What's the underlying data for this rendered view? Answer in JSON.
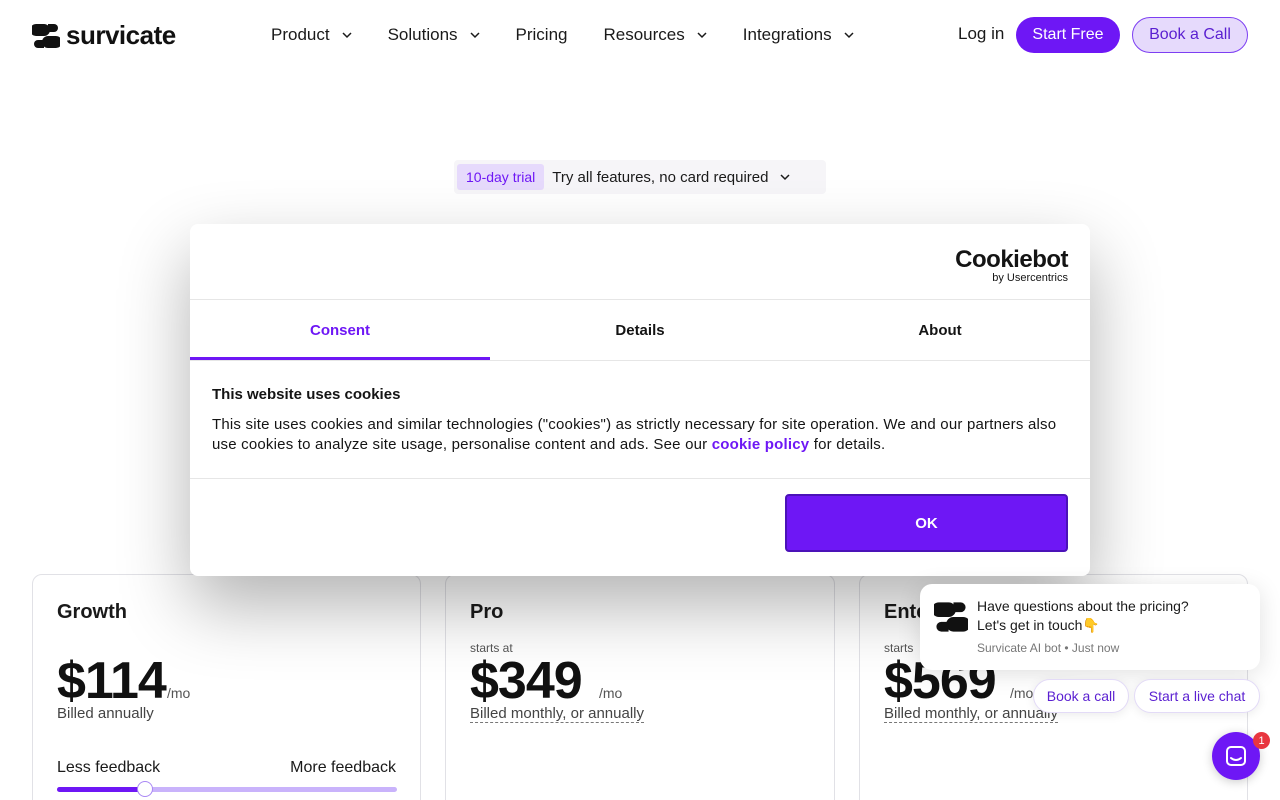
{
  "header": {
    "logo_text": "survicate",
    "menu": [
      {
        "label": "Product",
        "has_dropdown": true
      },
      {
        "label": "Solutions",
        "has_dropdown": true
      },
      {
        "label": "Pricing",
        "has_dropdown": false
      },
      {
        "label": "Resources",
        "has_dropdown": true
      },
      {
        "label": "Integrations",
        "has_dropdown": true
      }
    ],
    "login": "Log in",
    "start_free": "Start Free",
    "book_call": "Book a Call"
  },
  "trial": {
    "tag": "10-day trial",
    "text": "Try all features, no card required"
  },
  "cookie_dialog": {
    "logo_main": "Cookiebot",
    "logo_sub": "by Usercentrics",
    "tabs": [
      "Consent",
      "Details",
      "About"
    ],
    "active_tab": "Consent",
    "title": "This website uses cookies",
    "text_before": "This site uses cookies and similar technologies (\"cookies\") as strictly necessary for site operation. We and our partners also use cookies to analyze site usage, personalise content and ads. See our ",
    "link": "cookie policy",
    "text_after": " for details.",
    "ok": "OK"
  },
  "plans": {
    "growth": {
      "name": "Growth",
      "price": "$114",
      "per": "/mo",
      "billed": "Billed annually",
      "less_feedback": "Less feedback",
      "more_feedback": "More feedback",
      "slider_fraction": 0.26
    },
    "pro": {
      "name": "Pro",
      "starts": "starts at",
      "price": "$349",
      "per": "/mo",
      "billed": "Billed monthly, or annually"
    },
    "enterprise": {
      "name": "Ente",
      "starts": "starts",
      "price": "$569",
      "per": "/mo",
      "billed": "Billed monthly, or annually"
    }
  },
  "chat": {
    "line1": "Have questions about the pricing?",
    "line2": "Let's get in touch👇",
    "meta": "Survicate AI bot • Just now",
    "book_call": "Book a call",
    "live_chat": "Start a live chat",
    "badge_count": "1"
  },
  "colors": {
    "accent": "#6e17f5",
    "accent_light": "#e6dafc",
    "badge": "#e8363f"
  }
}
